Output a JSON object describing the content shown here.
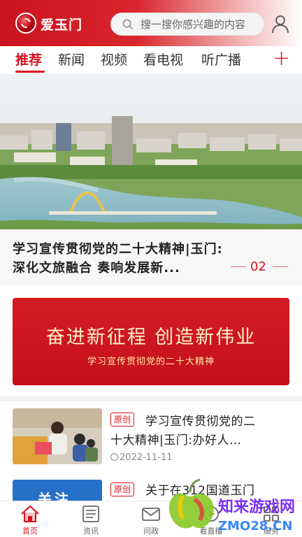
{
  "header": {
    "app_name": "爱玉门",
    "search_placeholder": "搜一搜你感兴趣的内容"
  },
  "tabs": [
    {
      "label": "推荐",
      "active": true
    },
    {
      "label": "新闻"
    },
    {
      "label": "视频"
    },
    {
      "label": "看电视"
    },
    {
      "label": "听广播"
    }
  ],
  "tab_add_label": "+",
  "banner": {
    "caption_line1": "学习宣传贯彻党的二十大精神|玉门:",
    "caption_line2": "深化文旅融合  奏响发展新...",
    "page_number": "02"
  },
  "promo": {
    "headline": "奋进新征程  创造新伟业",
    "subline": "学习宣传贯彻党的二十大精神"
  },
  "news": [
    {
      "badge": "原创",
      "title_line1": "学习宣传贯彻党的二",
      "title_line2": "十大精神|玉门:办好人…",
      "date": "2022-11-11"
    },
    {
      "badge": "原创",
      "title_line1": "关于在312国道玉门",
      "thumb_text": "关注"
    }
  ],
  "bottom_nav": [
    {
      "label": "首页",
      "icon": "home-icon",
      "active": true
    },
    {
      "label": "资讯",
      "icon": "news-icon"
    },
    {
      "label": "问政",
      "icon": "mail-icon"
    },
    {
      "label": "看直播",
      "icon": "live-icon"
    },
    {
      "label": "服务",
      "icon": "grid-icon"
    }
  ],
  "watermark": {
    "text": "知来游戏网",
    "url_text": "ZMO28.CN"
  },
  "colors": {
    "brand_red": "#d8111e",
    "header_red": "#c9141e"
  }
}
